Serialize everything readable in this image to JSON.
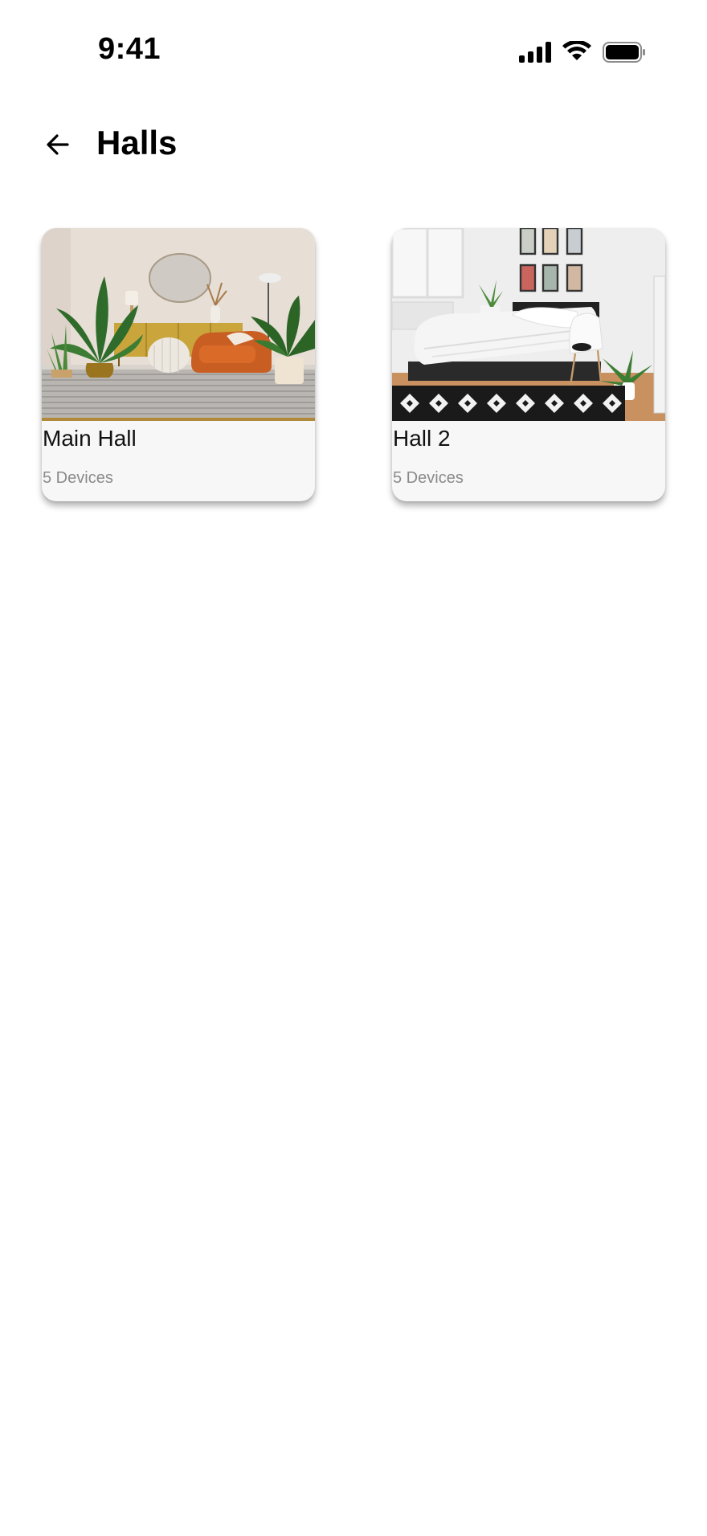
{
  "status_bar": {
    "time": "9:41",
    "icons": [
      "cellular-signal-icon",
      "wifi-icon",
      "battery-icon"
    ]
  },
  "header": {
    "back_icon": "arrow-left-icon",
    "title": "Halls"
  },
  "halls": [
    {
      "name": "Main Hall",
      "devices": "5 Devices",
      "image": "living-room-photo"
    },
    {
      "name": "Hall 2",
      "devices": "5 Devices",
      "image": "bedroom-photo"
    }
  ],
  "colors": {
    "background": "#ffffff",
    "card": "#f7f7f7",
    "subtext": "#8a8a8a",
    "text": "#000000"
  }
}
